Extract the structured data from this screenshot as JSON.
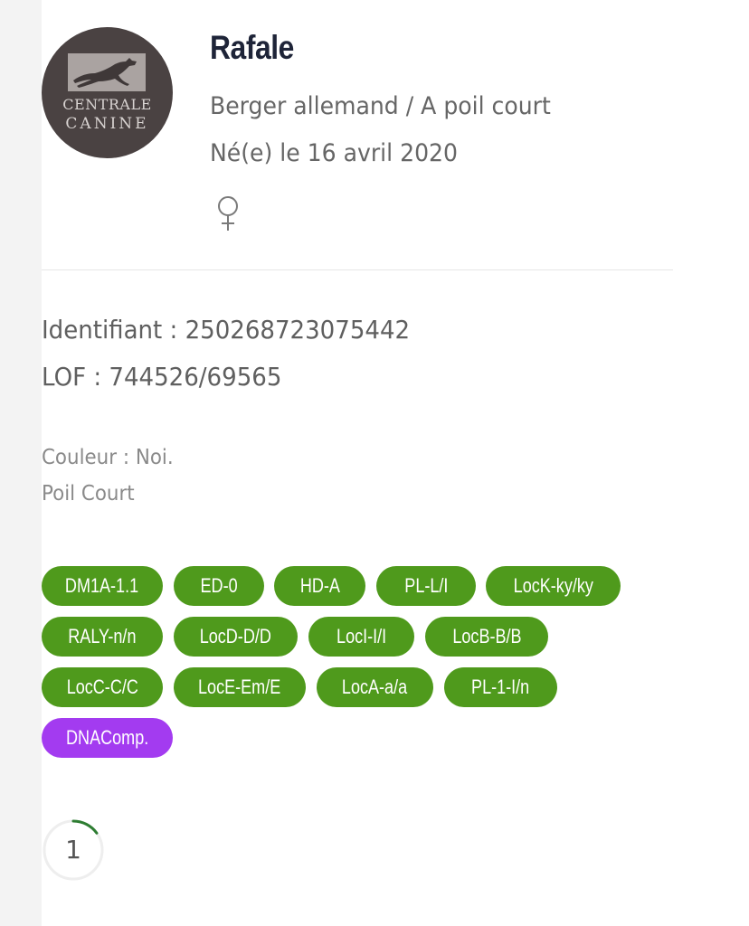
{
  "logo": {
    "line1": "CENTRALE",
    "line2": "CANINE",
    "icon": "running-dog-icon"
  },
  "dog": {
    "name": "Rafale",
    "breed": "Berger allemand / A poil court",
    "birth": "Né(e) le 16 avril 2020",
    "gender_icon": "female-symbol-icon"
  },
  "ids": {
    "identifiant": "Identifiant : 250268723075442",
    "lof": "LOF : 744526/69565"
  },
  "details": {
    "couleur": "Couleur : Noi.",
    "poil": "Poil Court"
  },
  "tags": [
    {
      "label": "DM1A-1.1",
      "color": "#4f9a1c"
    },
    {
      "label": "ED-0",
      "color": "#4f9a1c"
    },
    {
      "label": "HD-A",
      "color": "#4f9a1c"
    },
    {
      "label": "PL-L/I",
      "color": "#4f9a1c"
    },
    {
      "label": "LocK-ky/ky",
      "color": "#4f9a1c"
    },
    {
      "label": "RALY-n/n",
      "color": "#4f9a1c"
    },
    {
      "label": "LocD-D/D",
      "color": "#4f9a1c"
    },
    {
      "label": "LocI-I/I",
      "color": "#4f9a1c"
    },
    {
      "label": "LocB-B/B",
      "color": "#4f9a1c"
    },
    {
      "label": "LocC-C/C",
      "color": "#4f9a1c"
    },
    {
      "label": "LocE-Em/E",
      "color": "#4f9a1c"
    },
    {
      "label": "LocA-a/a",
      "color": "#4f9a1c"
    },
    {
      "label": "PL-1-I/n",
      "color": "#4f9a1c"
    },
    {
      "label": "DNAComp.",
      "color": "#a33bf0"
    }
  ],
  "progress": {
    "value": "1",
    "fill_fraction": 0.15,
    "color": "#2e7d32"
  }
}
